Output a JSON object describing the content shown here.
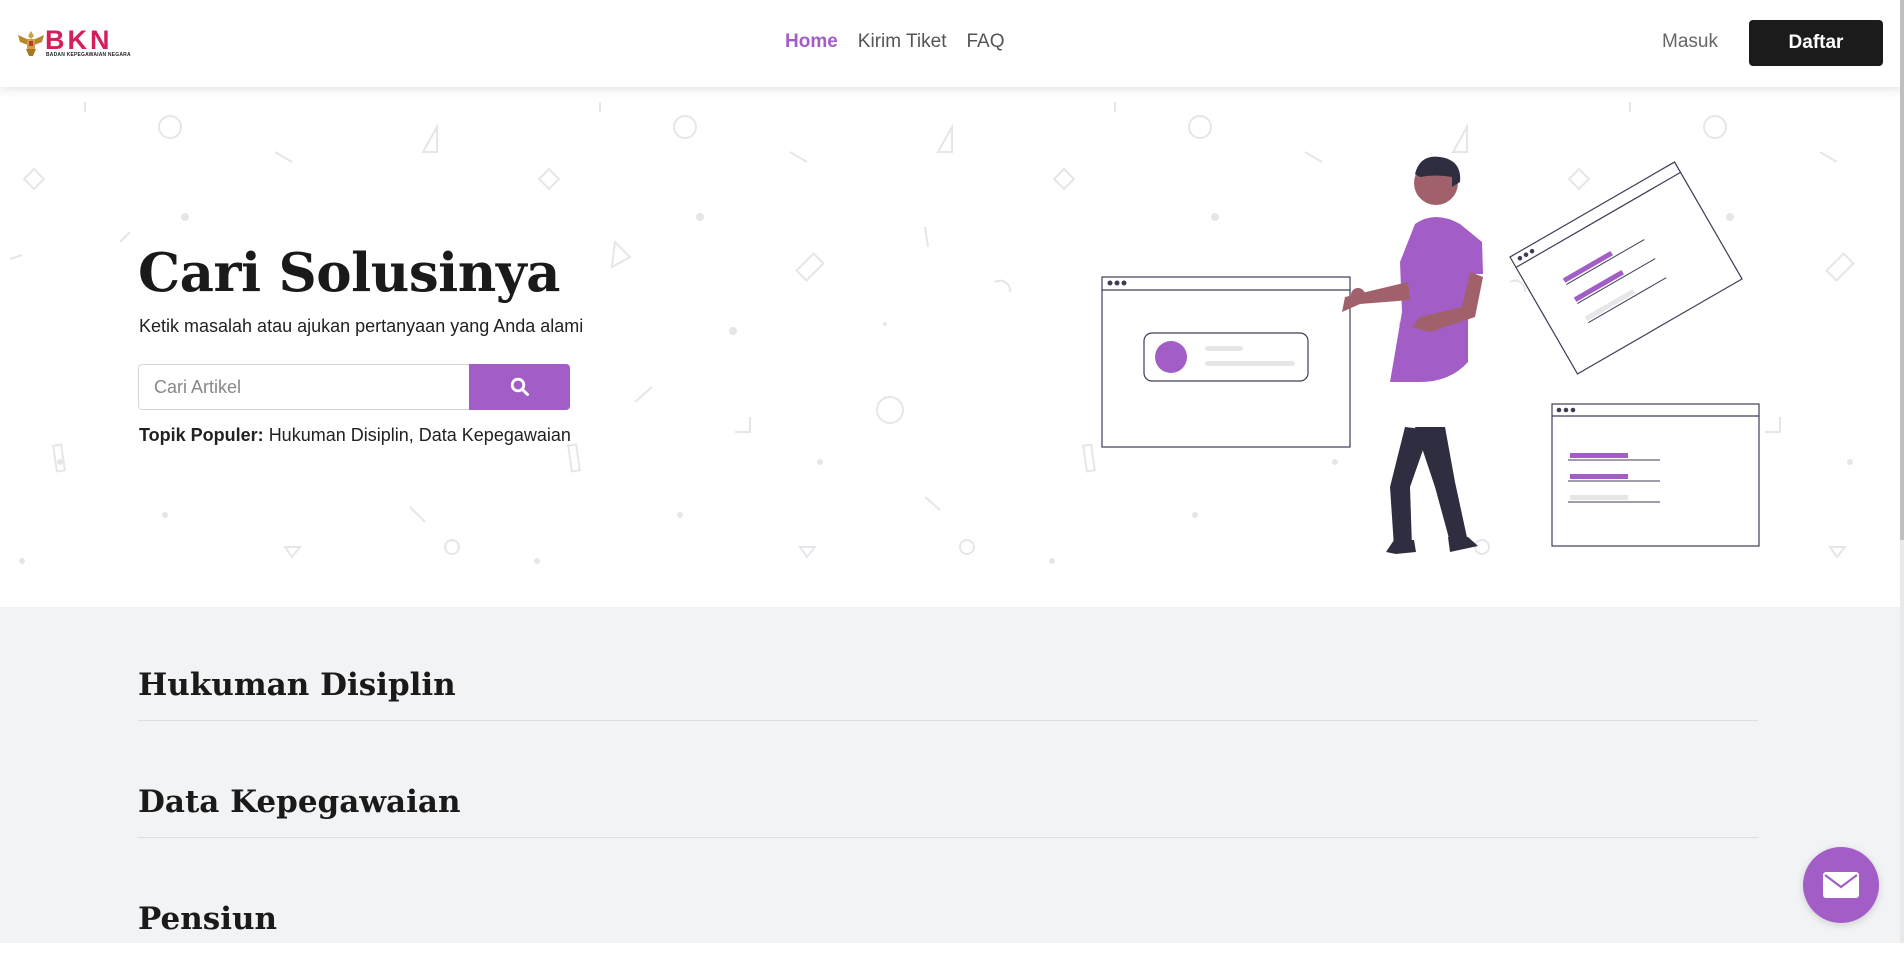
{
  "logo": {
    "word": "BKN",
    "subtitle": "BADAN KEPEGAWAIAN NEGARA"
  },
  "nav": {
    "home": "Home",
    "kirim_tiket": "Kirim Tiket",
    "faq": "FAQ"
  },
  "auth": {
    "masuk": "Masuk",
    "daftar": "Daftar"
  },
  "hero": {
    "title": "Cari Solusinya",
    "subtitle": "Ketik masalah atau ajukan pertanyaan yang Anda alami",
    "search_placeholder": "Cari Artikel",
    "popular_label": "Topik Populer:",
    "popular_topics": [
      "Hukuman Disiplin",
      "Data Kepegawaian"
    ]
  },
  "categories": [
    {
      "title": "Hukuman Disiplin"
    },
    {
      "title": "Data Kepegawaian"
    },
    {
      "title": "Pensiun"
    }
  ],
  "colors": {
    "accent": "#a25ec6",
    "dark_button": "#1b1b1b",
    "section_bg": "#f2f3f5",
    "brand_red": "#d61f5a"
  },
  "icons": {
    "search": "search-icon",
    "chat": "envelope-icon"
  }
}
